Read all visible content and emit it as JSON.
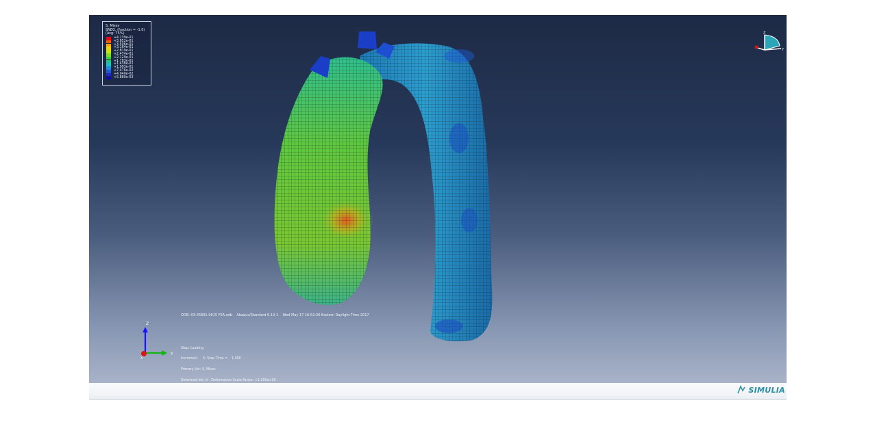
{
  "legend": {
    "title_lines": [
      "S, Mises",
      "SNEG, (fraction = -1.0)",
      "(Avg: 75%)"
    ],
    "values": [
      "+4.139e-01",
      "+3.852e-01",
      "+3.506e-01",
      "+3.164e-01",
      "+2.819e-01",
      "+2.474e-01",
      "+2.129e-01",
      "+1.783e-01",
      "+1.438e-01",
      "+1.093e-01",
      "+7.476e-02",
      "+4.040e-02",
      "+5.880e-03"
    ],
    "colors": [
      "#ff0000",
      "#ff5a00",
      "#ffa500",
      "#f0d400",
      "#c8e600",
      "#7ddc1e",
      "#3ad23a",
      "#1ec882",
      "#14c3c3",
      "#1e8cdc",
      "#1e5ad2",
      "#1e28c8",
      "#0a0ab4"
    ]
  },
  "viewport_info": {
    "odb_line": "ODB: 03-05891-0615 FEA.odb    Abaqus/Standard 6.13-1    Wed May 17 16:52:30 Eastern Daylight Time 2017",
    "status_lines": [
      "Step: Loading",
      "Increment     5: Step Time =    1.000",
      "Primary Var: S, Mises",
      "Deformed Var: U   Deformation Scale Factor: +1.000e+00"
    ]
  },
  "triad": {
    "z_label": "Z",
    "y_label": "Y",
    "x_label": "X"
  },
  "viewcube": {
    "z_label": "Z",
    "y_label": "Y"
  },
  "footer": {
    "brand": "SIMULIA",
    "brand_color": "#2a8fa6"
  }
}
